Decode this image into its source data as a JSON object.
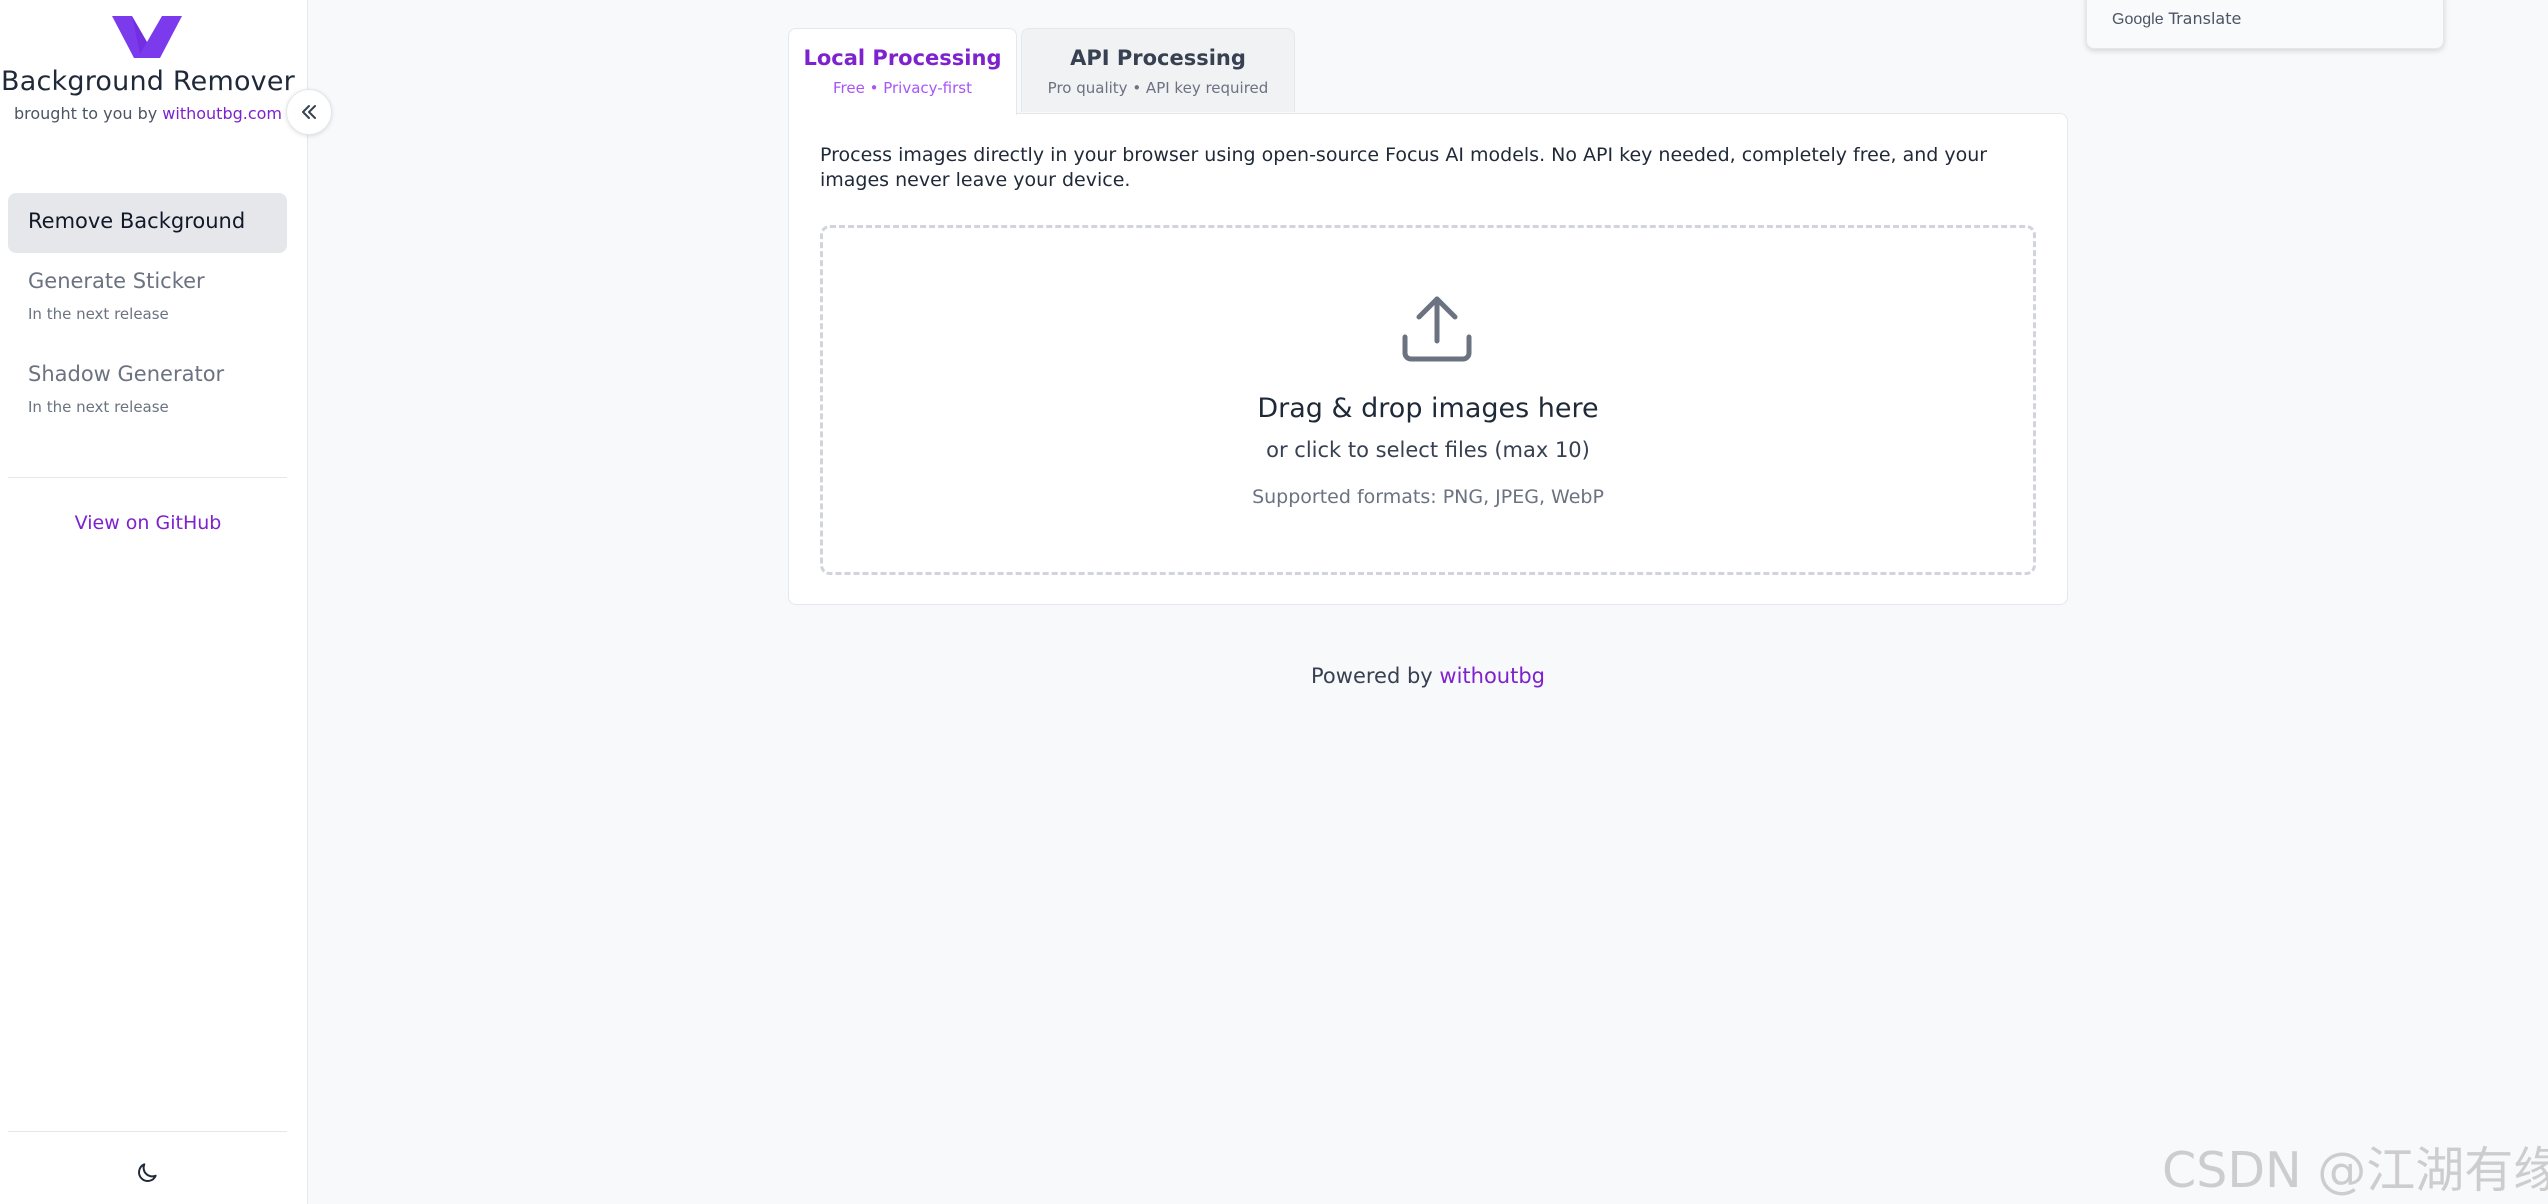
{
  "brand": {
    "title": "Background Remover",
    "subtitle_prefix": "brought to you by ",
    "subtitle_link": "withoutbg.com",
    "logo_color": "#7c3aed"
  },
  "sidebar": {
    "collapse_icon": "double-chevron-left-icon",
    "items": [
      {
        "label": "Remove Background",
        "sub": ""
      },
      {
        "label": "Generate Sticker",
        "sub": "In the next release"
      },
      {
        "label": "Shadow Generator",
        "sub": "In the next release"
      }
    ],
    "github_link": "View on GitHub",
    "theme_icon": "moon-icon"
  },
  "tabs": [
    {
      "title": "Local Processing",
      "sub": "Free • Privacy-first"
    },
    {
      "title": "API Processing",
      "sub": "Pro quality • API key required"
    }
  ],
  "panel": {
    "description": "Process images directly in your browser using open-source Focus AI models. No API key needed, completely free, and your images never leave your device.",
    "dropzone": {
      "icon": "upload-icon",
      "title": "Drag & drop images here",
      "subtitle": "or click to select files (max 10)",
      "formats": "Supported formats: PNG, JPEG, WebP"
    }
  },
  "footer": {
    "prefix": "Powered by ",
    "link": "withoutbg"
  },
  "translate_widget": {
    "brand": "Google",
    "label": " Translate"
  },
  "watermark": "CSDN @江湖有缘",
  "colors": {
    "accent": "#7e22ce",
    "active_nav_bg": "#e5e7eb"
  }
}
